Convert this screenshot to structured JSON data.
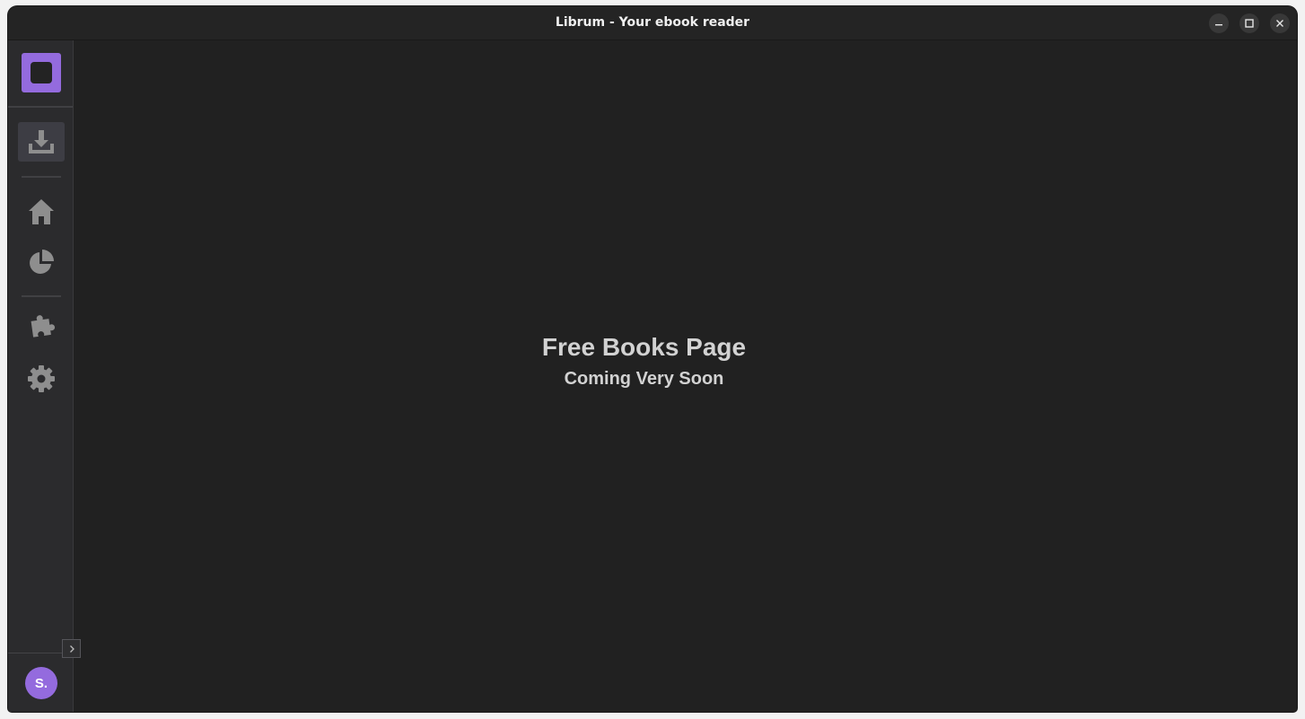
{
  "window": {
    "title": "Librum - Your ebook reader",
    "controls": {
      "minimize_icon": "minimize-icon",
      "maximize_icon": "maximize-icon",
      "close_icon": "close-icon"
    }
  },
  "sidebar": {
    "logo_icon": "librum-logo-icon",
    "items": [
      {
        "id": "free-books",
        "icon": "download-icon",
        "active": true
      },
      {
        "id": "home",
        "icon": "home-icon",
        "active": false
      },
      {
        "id": "statistics",
        "icon": "pie-chart-icon",
        "active": false
      },
      {
        "id": "add-ons",
        "icon": "puzzle-icon",
        "active": false
      },
      {
        "id": "settings",
        "icon": "gear-icon",
        "active": false
      }
    ],
    "profile": {
      "initials": "S."
    },
    "expand_icon": "chevron-right-icon"
  },
  "main": {
    "title": "Free Books Page",
    "subtitle": "Coming Very Soon"
  },
  "colors": {
    "accent": "#946bde",
    "background": "#212121",
    "sidebar": "#2b2b2d",
    "icon": "#8e8e8e",
    "text": "#d2d2d2"
  }
}
